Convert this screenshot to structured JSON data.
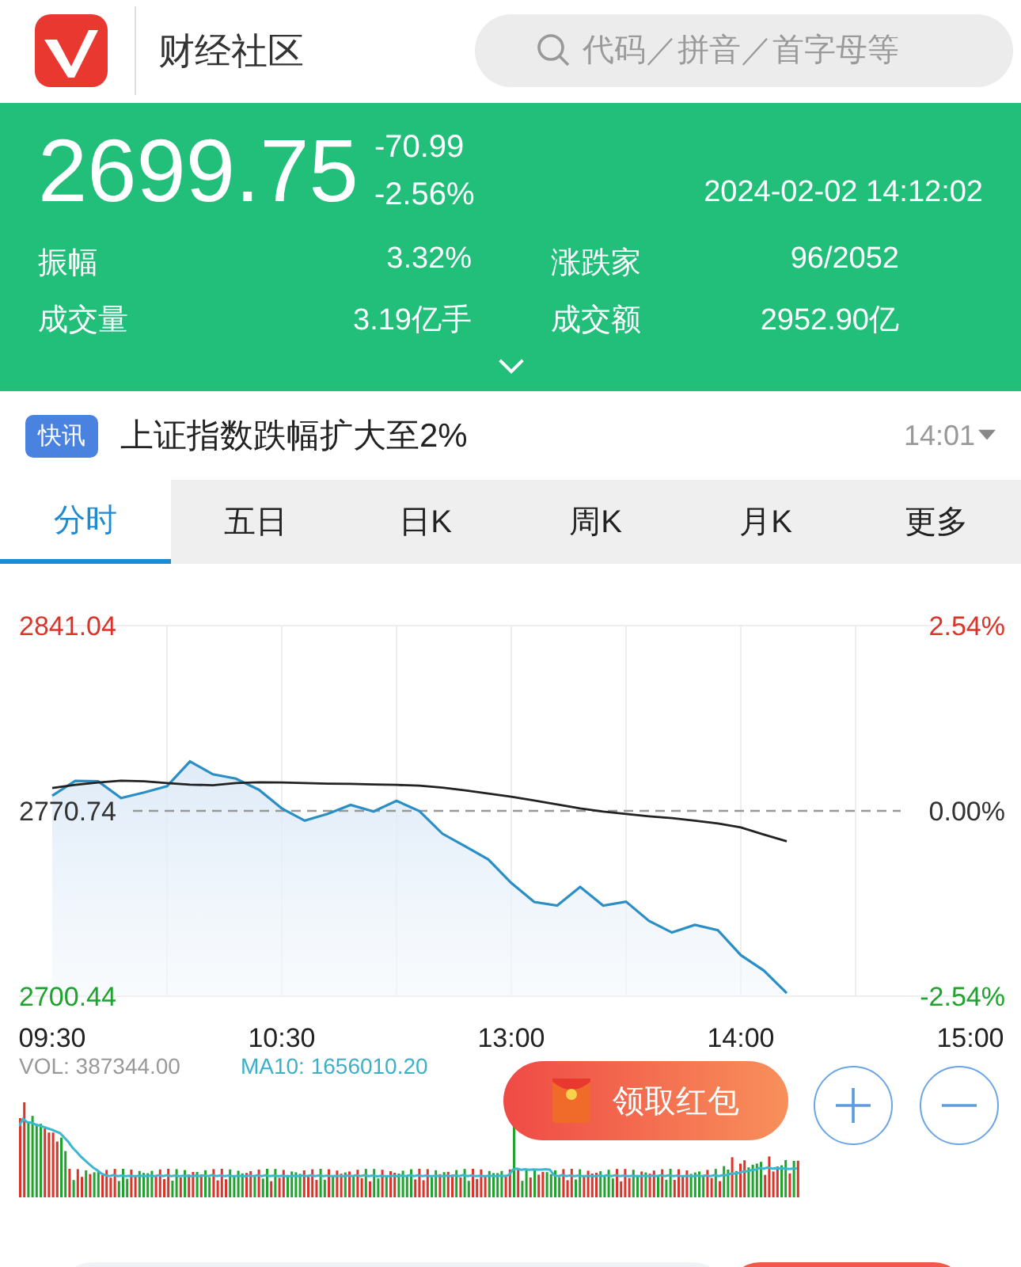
{
  "header": {
    "title": "财经社区",
    "search": {
      "placeholder": "代码／拼音／首字母等"
    }
  },
  "quote": {
    "price": "2699.75",
    "change": "-70.99",
    "change_pct": "-2.56%",
    "datetime": "2024-02-02 14:12:02",
    "stats": [
      {
        "label": "振幅",
        "value": "3.32%"
      },
      {
        "label": "涨跌家",
        "value": "96/2052"
      },
      {
        "label": "成交量",
        "value": "3.19亿手"
      },
      {
        "label": "成交额",
        "value": "2952.90亿"
      }
    ]
  },
  "news": {
    "badge": "快讯",
    "headline": "上证指数跌幅扩大至2%",
    "time": "14:01"
  },
  "tabs": [
    {
      "label": "分时",
      "selected": true
    },
    {
      "label": "五日",
      "selected": false
    },
    {
      "label": "日K",
      "selected": false
    },
    {
      "label": "周K",
      "selected": false
    },
    {
      "label": "月K",
      "selected": false
    },
    {
      "label": "更多",
      "selected": false
    }
  ],
  "chart": {
    "percent_labels": [
      {
        "text": "2.54%",
        "color": "#d9352b"
      },
      {
        "text": "0.00%",
        "color": "#333333"
      },
      {
        "text": "-2.54%",
        "color": "#1fa32e"
      }
    ],
    "chart_data": {
      "type": "line",
      "grid": true,
      "ylim": [
        2700.44,
        2841.04
      ],
      "categories": [
        "09:30",
        null,
        null,
        null,
        null,
        null,
        null,
        null,
        null,
        null,
        "10:30",
        null,
        null,
        null,
        null,
        null,
        null,
        null,
        null,
        null,
        "13:00",
        null,
        null,
        null,
        null,
        null,
        null,
        null,
        null,
        null,
        "14:00",
        null,
        null,
        null,
        null,
        null,
        null,
        null,
        null,
        null,
        "15:00"
      ],
      "yticks": [
        {
          "value": 2841.04,
          "label": "2841.04"
        },
        {
          "value": 2770.74,
          "label": "2770.74"
        },
        {
          "value": 2700.44,
          "label": "2700.44"
        }
      ],
      "series": [
        {
          "color": "#2a8fc4",
          "values": [
            2776.5,
            2782.1,
            2782.0,
            2775.6,
            2777.7,
            2780.1,
            2789.5,
            2784.6,
            2783.0,
            2778.8,
            2771.7,
            2767.0,
            2769.6,
            2773.0,
            2770.5,
            2774.6,
            2770.6,
            2762.1,
            2757.3,
            2752.3,
            2743.4,
            2736.2,
            2734.8,
            2741.9,
            2734.8,
            2736.3,
            2729.0,
            2724.6,
            2727.5,
            2725.5,
            2716.0,
            2710.2,
            2701.6,
            null,
            null,
            null,
            null,
            null,
            null,
            null,
            null
          ]
        },
        {
          "color": "#222222",
          "values": [
            2779.4,
            2780.6,
            2781.5,
            2782.2,
            2782.0,
            2781.3,
            2780.7,
            2780.5,
            2781.3,
            2781.6,
            2781.5,
            2781.3,
            2781.1,
            2781.0,
            2780.8,
            2780.6,
            2780.3,
            2779.6,
            2778.5,
            2777.3,
            2776.1,
            2774.7,
            2773.2,
            2771.7,
            2770.5,
            2769.6,
            2768.7,
            2768.0,
            2767.0,
            2766.0,
            2764.5,
            2761.8,
            2759.2,
            null,
            null,
            null,
            null,
            null,
            null,
            null,
            null
          ]
        }
      ]
    }
  },
  "volume": {
    "vol": "VOL: 387344.00",
    "ma10": "MA10: 1656010.20"
  },
  "actions": {
    "red_packet": "领取红包"
  }
}
